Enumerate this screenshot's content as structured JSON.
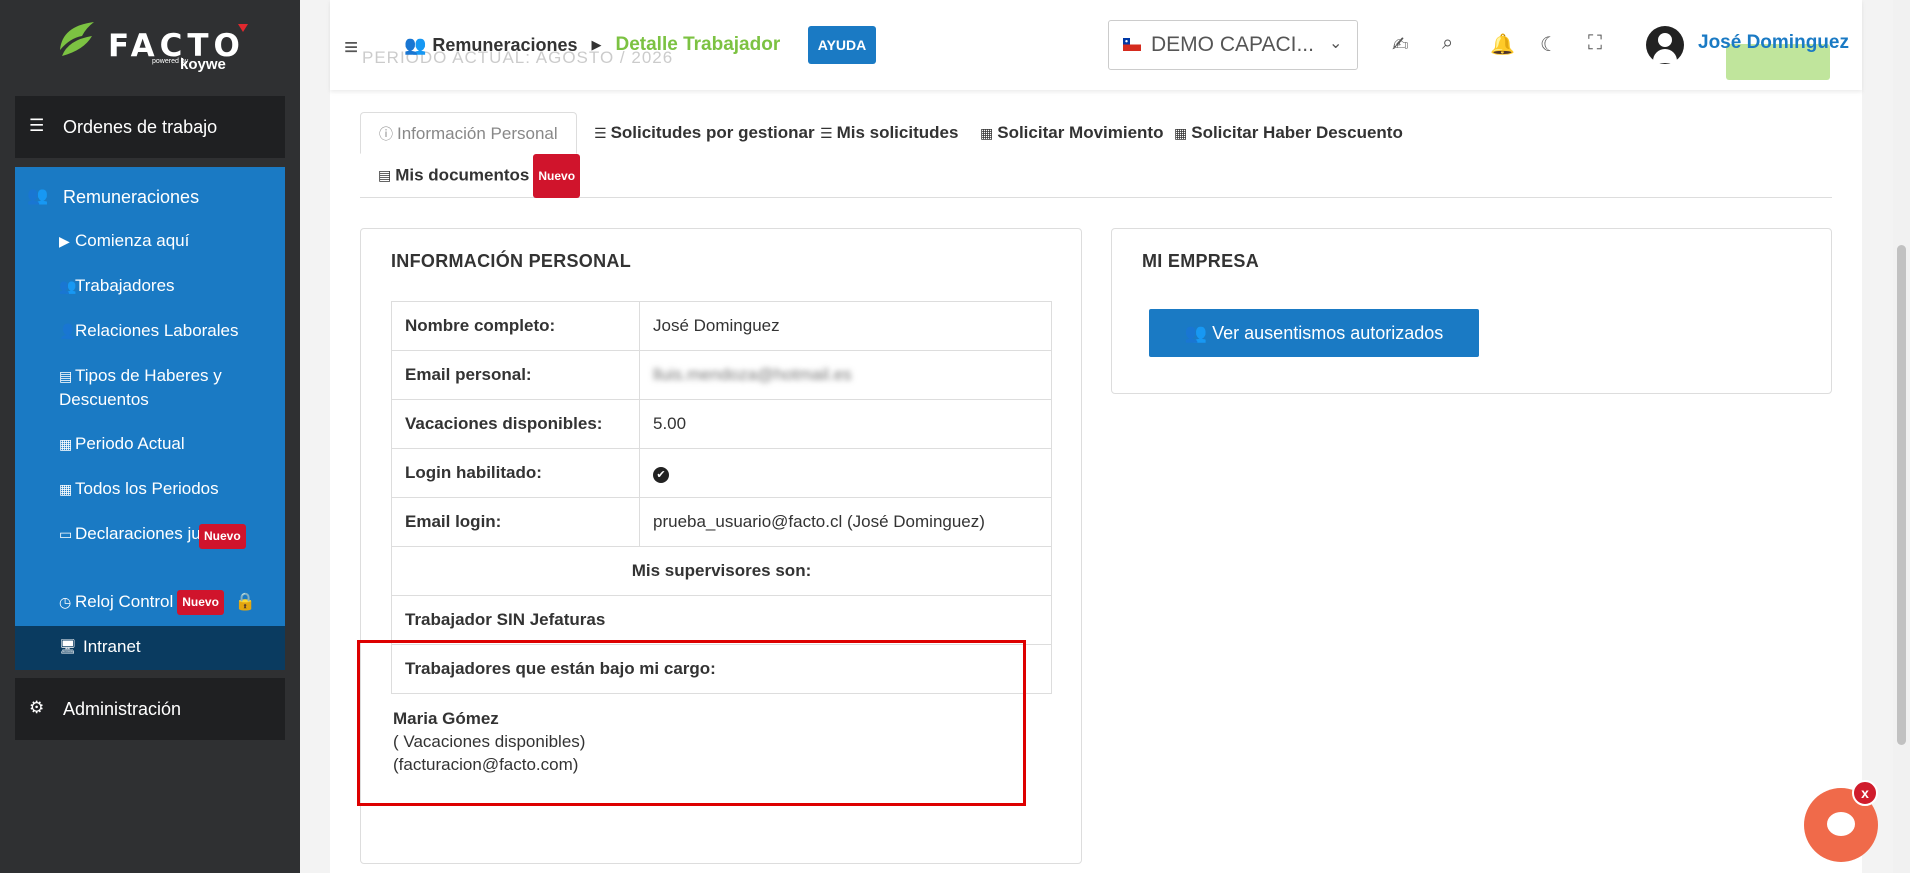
{
  "sidebar": {
    "logo": {
      "brand": "FACTO",
      "powered": "powered by",
      "partner": "koywe"
    },
    "ordenes": "Ordenes de trabajo",
    "remuneraciones": "Remuneraciones",
    "items": [
      {
        "label": "Comienza aquí",
        "icon": "play-icon"
      },
      {
        "label": "Trabajadores",
        "icon": "users-icon"
      },
      {
        "label": "Relaciones Laborales",
        "icon": "user-group-icon"
      },
      {
        "label": "Tipos de Haberes y Descuentos",
        "icon": "file-icon"
      },
      {
        "label": "Periodo Actual",
        "icon": "calendar-icon"
      },
      {
        "label": "Todos los Periodos",
        "icon": "calendar-grid-icon"
      },
      {
        "label": "Declaraciones juradas",
        "icon": "archive-icon",
        "badge": "Nuevo"
      },
      {
        "label": "Reloj Control",
        "icon": "clock-icon",
        "badge": "Nuevo"
      },
      {
        "label": "Intranet",
        "icon": "intranet-icon"
      }
    ],
    "admin": "Administración"
  },
  "header": {
    "faded_title": "PERIODO ACTUAL: AGOSTO / 2026",
    "breadcrumb": {
      "parent": "Remuneraciones",
      "current": "Detalle Trabajador"
    },
    "help_button": "AYUDA",
    "company": "DEMO CAPACI...",
    "user_name": "José Dominguez"
  },
  "tabs": [
    {
      "label": "Información Personal",
      "active": true
    },
    {
      "label": "Solicitudes por gestionar"
    },
    {
      "label": "Mis solicitudes"
    },
    {
      "label": "Solicitar Movimiento"
    },
    {
      "label": "Solicitar Haber Descuento"
    },
    {
      "label": "Mis documentos",
      "badge": "Nuevo"
    }
  ],
  "personal": {
    "title": "INFORMACIÓN PERSONAL",
    "rows": [
      {
        "label": "Nombre completo:",
        "value": "José Dominguez"
      },
      {
        "label": "Email personal:",
        "value": "lluis.mendoza@hotmail.es"
      },
      {
        "label": "Vacaciones disponibles:",
        "value": "5.00"
      },
      {
        "label": "Login habilitado:",
        "value": "✔"
      },
      {
        "label": "Email login:",
        "value": "prueba_usuario@facto.cl (José Dominguez)"
      }
    ],
    "supervisors_header": "Mis supervisores son:",
    "supervisors_value": "Trabajador SIN Jefaturas",
    "subordinates_header": "Trabajadores que están bajo mi cargo:",
    "subordinate": {
      "name": "Maria Gómez",
      "vacaciones": "( Vacaciones disponibles)",
      "email": "(facturacion@facto.com)"
    }
  },
  "empresa": {
    "title": "MI EMPRESA",
    "button": "Ver ausentismos autorizados"
  },
  "chat": {
    "close": "x"
  },
  "colors": {
    "sidebar": "#2f3032",
    "primary": "#1a7ac4",
    "accent_green": "#7cc242",
    "badge_red": "#d0142c"
  }
}
